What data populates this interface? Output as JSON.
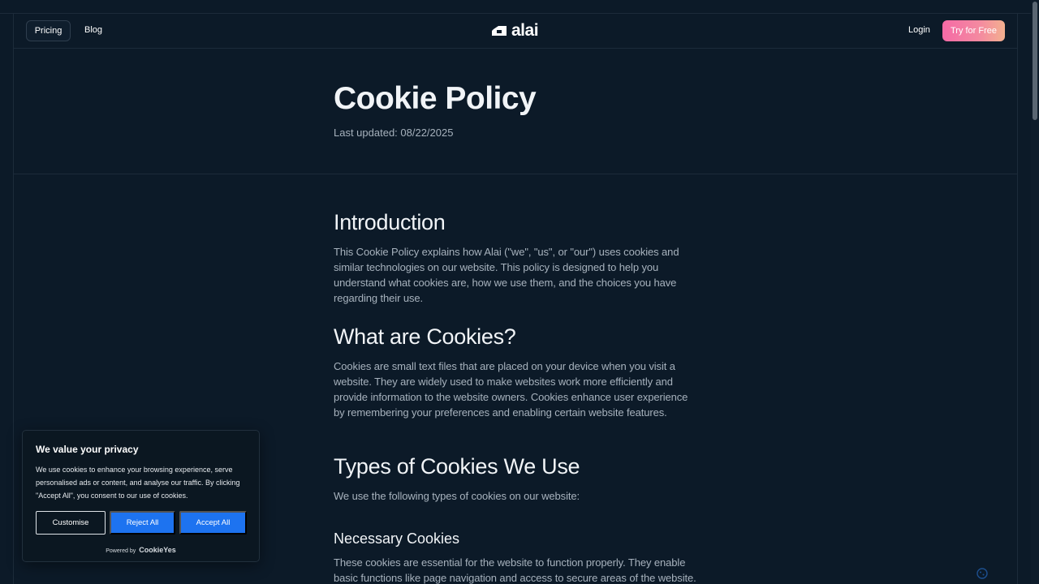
{
  "nav": {
    "pricing": "Pricing",
    "blog": "Blog",
    "logo": "alai",
    "login": "Login",
    "cta": "Try for Free"
  },
  "hero": {
    "title": "Cookie Policy",
    "updated": "Last updated: 08/22/2025"
  },
  "sections": {
    "intro_heading": "Introduction",
    "intro_text": "This Cookie Policy explains how Alai (\"we\", \"us\", or \"our\") uses cookies and similar technologies on our website. This policy is designed to help you understand what cookies are, how we use them, and the choices you have regarding their use.",
    "what_heading": "What are Cookies?",
    "what_text": "Cookies are small text files that are placed on your device when you visit a website. They are widely used to make websites work more efficiently and provide information to the website owners. Cookies enhance user experience by remembering your preferences and enabling certain website features.",
    "types_heading": "Types of Cookies We Use",
    "types_text": "We use the following types of cookies on our website:",
    "necessary_heading": "Necessary Cookies",
    "necessary_text": "These cookies are essential for the website to function properly. They enable basic functions like page navigation and access to secure areas of the website."
  },
  "consent": {
    "title": "We value your privacy",
    "body": "We use cookies to enhance your browsing experience, serve personalised ads or content, and analyse our traffic. By clicking \"Accept All\", you consent to our use of cookies.",
    "customise": "Customise",
    "reject": "Reject All",
    "accept": "Accept All",
    "powered_label": "Powered by",
    "powered_brand": "CookieYes"
  },
  "colors": {
    "background": "#0c1a28",
    "cta_gradient_start": "#f56aa6",
    "cta_gradient_end": "#f3b08f",
    "consent_button": "#1d73f0"
  },
  "icons": [
    "alai-logo-icon",
    "cookie-settings-icon"
  ]
}
